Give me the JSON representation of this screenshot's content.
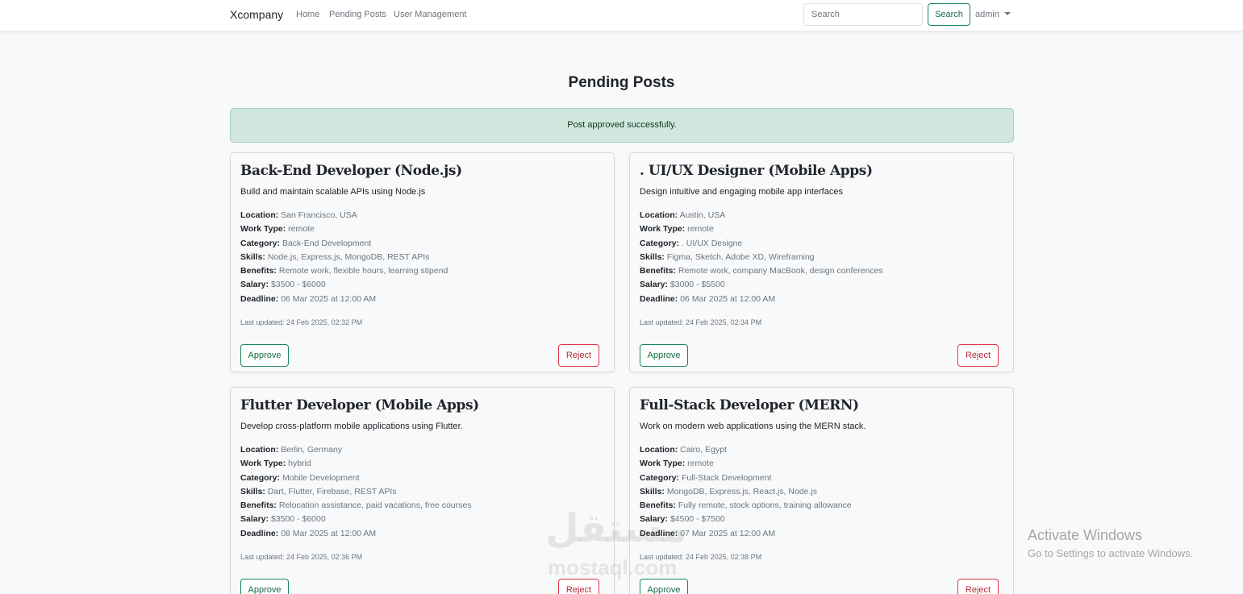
{
  "navbar": {
    "brand": "Xcompany",
    "links": [
      "Home",
      "Pending Posts",
      "User Management"
    ],
    "search_placeholder": "Search",
    "search_button": "Search",
    "user": "admin"
  },
  "page_title": "Pending Posts",
  "alert": "Post approved successfully.",
  "labels": {
    "location": "Location:",
    "work_type": "Work Type:",
    "category": "Category:",
    "skills": "Skills:",
    "benefits": "Benefits:",
    "salary": "Salary:",
    "deadline": "Deadline:",
    "approve": "Approve",
    "reject": "Reject"
  },
  "posts": [
    {
      "title": "Back-End Developer (Node.js)",
      "description": "Build and maintain scalable APIs using Node.js",
      "location": "San Francisco, USA",
      "work_type": "remote",
      "category": "Back-End Development",
      "skills": "Node.js, Express.js, MongoDB, REST APIs",
      "benefits": "Remote work, flexible hours, learning stipend",
      "salary": "$3500 - $6000",
      "deadline": "06 Mar 2025 at 12:00 AM",
      "updated": "Last updated: 24 Feb 2025, 02:32 PM"
    },
    {
      "title": ". UI/UX Designer (Mobile Apps)",
      "description": "Design intuitive and engaging mobile app interfaces",
      "location": "Austin, USA",
      "work_type": "remote",
      "category": ". UI/UX Designe",
      "skills": "Figma, Sketch, Adobe XD, Wireframing",
      "benefits": "Remote work, company MacBook, design conferences",
      "salary": "$3000 - $5500",
      "deadline": "06 Mar 2025 at 12:00 AM",
      "updated": "Last updated: 24 Feb 2025, 02:34 PM"
    },
    {
      "title": "Flutter Developer (Mobile Apps)",
      "description": "Develop cross-platform mobile applications using Flutter.",
      "location": "Berlin, Germany",
      "work_type": "hybrid",
      "category": "Mobile Development",
      "skills": "Dart, Flutter, Firebase, REST APIs",
      "benefits": "Relocation assistance, paid vacations, free courses",
      "salary": "$3500 - $6000",
      "deadline": "08 Mar 2025 at 12:00 AM",
      "updated": "Last updated: 24 Feb 2025, 02:36 PM"
    },
    {
      "title": "Full-Stack Developer (MERN)",
      "description": "Work on modern web applications using the MERN stack.",
      "location": "Cairo, Egypt",
      "work_type": "remote",
      "category": "Full-Stack Development",
      "skills": "MongoDB, Express.js, React.js, Node.js",
      "benefits": "Fully remote, stock options, training allowance",
      "salary": "$4500 - $7500",
      "deadline": "07 Mar 2025 at 12:00 AM",
      "updated": "Last updated: 24 Feb 2025, 02:38 PM"
    }
  ],
  "watermark": {
    "arabic": "مستقل",
    "latin": "mostaql.com"
  },
  "activation": {
    "title": "Activate Windows",
    "subtitle": "Go to Settings to activate Windows."
  }
}
